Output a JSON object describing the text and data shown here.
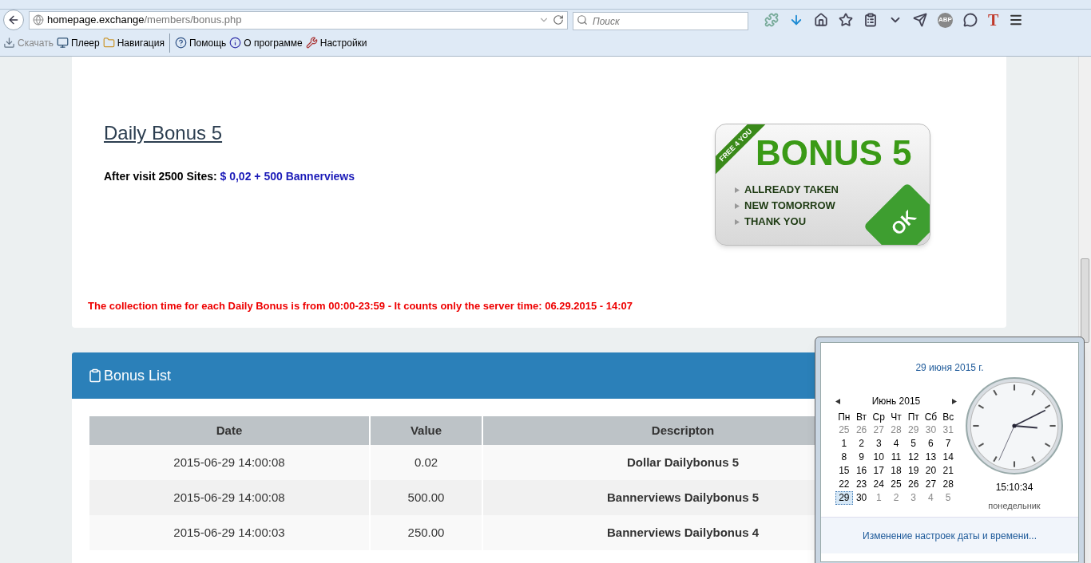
{
  "browser": {
    "address": {
      "host": "homepage.exchange",
      "path": "/members/bonus.php"
    },
    "search": {
      "placeholder": "Поиск"
    },
    "toolbar": [
      {
        "kind": "icon"
      },
      {
        "kind": "icon"
      },
      {
        "kind": "icon"
      },
      {
        "kind": "icon"
      },
      {
        "kind": "icon"
      },
      {
        "kind": "icon"
      },
      {
        "kind": "icon"
      },
      {
        "kind": "text",
        "label": "ABP"
      },
      {
        "kind": "icon"
      },
      {
        "kind": "text",
        "label": "T"
      },
      {
        "kind": "icon"
      }
    ],
    "bookmarks": [
      {
        "label": "Скачать",
        "disabled": true
      },
      {
        "label": "Плеер",
        "disabled": false
      },
      {
        "label": "Навигация",
        "disabled": false
      },
      {
        "label": "Помощь",
        "disabled": false
      },
      {
        "label": "О программе",
        "disabled": false
      },
      {
        "label": "Настройки",
        "disabled": false
      }
    ]
  },
  "bonus": {
    "title": "Daily Bonus 5",
    "requirement": "After visit 2500 Sites: ",
    "reward": "$ 0,02 + 500 Bannerviews",
    "notice": "The collection time for each Daily Bonus is from 00:00-23:59 - It counts only the server time: 06.29.2015 - 14:07",
    "banner": {
      "ribbon": "FREE 4 YOU",
      "title": "BONUS 5",
      "lines": [
        "ALLREADY TAKEN",
        "NEW TOMORROW",
        "THANK YOU"
      ],
      "button": "OK"
    }
  },
  "bonus_list": {
    "title": "Bonus List",
    "columns": [
      "Date",
      "Value",
      "Descripton"
    ],
    "rows": [
      [
        "2015-06-29 14:00:08",
        "0.02",
        "Dollar Dailybonus 5"
      ],
      [
        "2015-06-29 14:00:08",
        "500.00",
        "Bannerviews Dailybonus 5"
      ],
      [
        "2015-06-29 14:00:03",
        "250.00",
        "Bannerviews Dailybonus 4"
      ]
    ]
  },
  "clock_popup": {
    "date": "29 июня 2015 г.",
    "month": "Июнь 2015",
    "weekdays": [
      "Пн",
      "Вт",
      "Ср",
      "Чт",
      "Пт",
      "Сб",
      "Вс"
    ],
    "days": [
      {
        "label": "25",
        "current_month": false,
        "selected": false
      },
      {
        "label": "26",
        "current_month": false,
        "selected": false
      },
      {
        "label": "27",
        "current_month": false,
        "selected": false
      },
      {
        "label": "28",
        "current_month": false,
        "selected": false
      },
      {
        "label": "29",
        "current_month": false,
        "selected": false
      },
      {
        "label": "30",
        "current_month": false,
        "selected": false
      },
      {
        "label": "31",
        "current_month": false,
        "selected": false
      },
      {
        "label": "1",
        "current_month": true,
        "selected": false
      },
      {
        "label": "2",
        "current_month": true,
        "selected": false
      },
      {
        "label": "3",
        "current_month": true,
        "selected": false
      },
      {
        "label": "4",
        "current_month": true,
        "selected": false
      },
      {
        "label": "5",
        "current_month": true,
        "selected": false
      },
      {
        "label": "6",
        "current_month": true,
        "selected": false
      },
      {
        "label": "7",
        "current_month": true,
        "selected": false
      },
      {
        "label": "8",
        "current_month": true,
        "selected": false
      },
      {
        "label": "9",
        "current_month": true,
        "selected": false
      },
      {
        "label": "10",
        "current_month": true,
        "selected": false
      },
      {
        "label": "11",
        "current_month": true,
        "selected": false
      },
      {
        "label": "12",
        "current_month": true,
        "selected": false
      },
      {
        "label": "13",
        "current_month": true,
        "selected": false
      },
      {
        "label": "14",
        "current_month": true,
        "selected": false
      },
      {
        "label": "15",
        "current_month": true,
        "selected": false
      },
      {
        "label": "16",
        "current_month": true,
        "selected": false
      },
      {
        "label": "17",
        "current_month": true,
        "selected": false
      },
      {
        "label": "18",
        "current_month": true,
        "selected": false
      },
      {
        "label": "19",
        "current_month": true,
        "selected": false
      },
      {
        "label": "20",
        "current_month": true,
        "selected": false
      },
      {
        "label": "21",
        "current_month": true,
        "selected": false
      },
      {
        "label": "22",
        "current_month": true,
        "selected": false
      },
      {
        "label": "23",
        "current_month": true,
        "selected": false
      },
      {
        "label": "24",
        "current_month": true,
        "selected": false
      },
      {
        "label": "25",
        "current_month": true,
        "selected": false
      },
      {
        "label": "26",
        "current_month": true,
        "selected": false
      },
      {
        "label": "27",
        "current_month": true,
        "selected": false
      },
      {
        "label": "28",
        "current_month": true,
        "selected": false
      },
      {
        "label": "29",
        "current_month": true,
        "selected": true
      },
      {
        "label": "30",
        "current_month": true,
        "selected": false
      },
      {
        "label": "1",
        "current_month": false,
        "selected": false
      },
      {
        "label": "2",
        "current_month": false,
        "selected": false
      },
      {
        "label": "3",
        "current_month": false,
        "selected": false
      },
      {
        "label": "4",
        "current_month": false,
        "selected": false
      },
      {
        "label": "5",
        "current_month": false,
        "selected": false
      }
    ],
    "time": "15:10:34",
    "weekday": "понедельник",
    "settings_link": "Изменение настроек даты и времени..."
  }
}
